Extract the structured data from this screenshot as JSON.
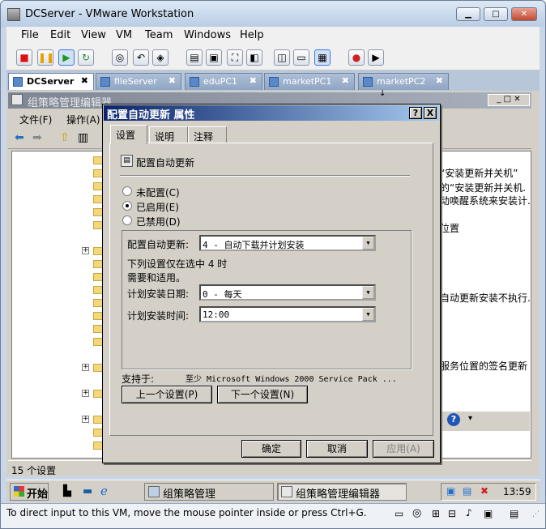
{
  "vmware": {
    "title": "DCServer - VMware Workstation",
    "menu": [
      "File",
      "Edit",
      "View",
      "VM",
      "Team",
      "Windows",
      "Help"
    ],
    "tabs": [
      {
        "label": "DCServer",
        "active": true
      },
      {
        "label": "fileServer",
        "active": false
      },
      {
        "label": "eduPC1",
        "active": false
      },
      {
        "label": "marketPC1",
        "active": false
      },
      {
        "label": "marketPC2",
        "active": false
      }
    ],
    "tab_close": "✖",
    "status_message": "To direct input to this VM, move the mouse pointer inside or press Ctrl+G."
  },
  "gpe": {
    "title": "组策略管理编辑器",
    "menu": [
      "文件(F)",
      "操作(A)"
    ],
    "status": "15 个设置",
    "right_pane_lines": [
      "“安装更新并关机”",
      "的“安装更新并关机.",
      "动唤醒系统来安装计.",
      "位置",
      "自动更新安装不执行.",
      "服务位置的签名更新"
    ]
  },
  "taskbar": {
    "start": "开始",
    "items": [
      "组策略管理",
      "组策略管理编辑器"
    ],
    "clock": "13:59"
  },
  "dialog": {
    "title": "配置自动更新 属性",
    "help_btn": "?",
    "close_btn": "X",
    "tabs": [
      "设置",
      "说明",
      "注释"
    ],
    "policy_name": "配置自动更新",
    "radios": [
      {
        "label": "未配置(C)",
        "checked": false
      },
      {
        "label": "已启用(E)",
        "checked": true
      },
      {
        "label": "已禁用(D)",
        "checked": false
      }
    ],
    "options": {
      "configure_label": "配置自动更新:",
      "configure_value": "4 - 自动下载并计划安装",
      "note_line1": "下列设置仅在选中 4 时",
      "note_line2": "需要和适用。",
      "day_label": "计划安装日期:",
      "day_value": "0 - 每天",
      "time_label": "计划安装时间:",
      "time_value": "12:00"
    },
    "supported_label": "支持于:",
    "supported_value": "至少 Microsoft Windows 2000 Service Pack ...",
    "prev_btn": "上一个设置(P)",
    "next_btn": "下一个设置(N)",
    "ok_btn": "确定",
    "cancel_btn": "取消",
    "apply_btn": "应用(A)"
  }
}
